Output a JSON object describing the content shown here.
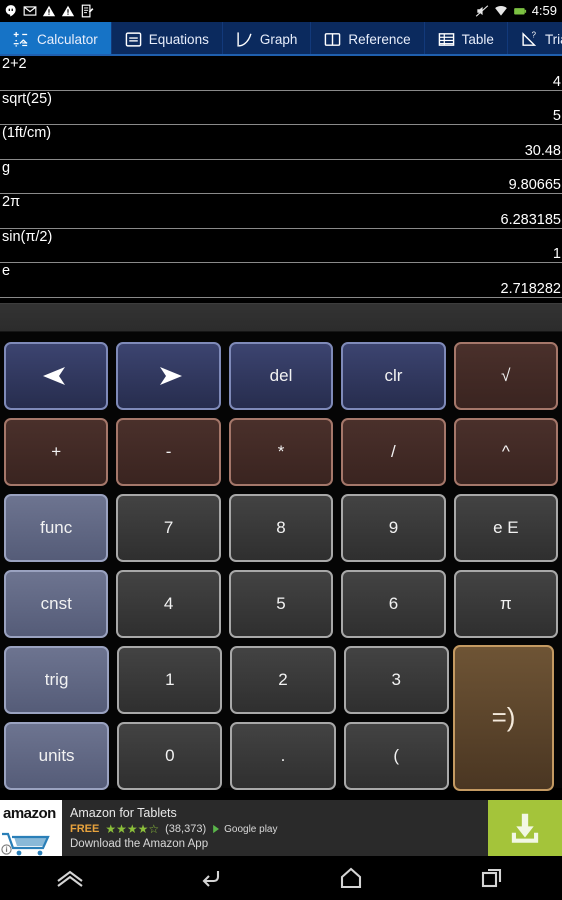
{
  "status_bar": {
    "left_icons": [
      "hangouts-icon",
      "gmail-icon",
      "warning-icon",
      "warning-icon",
      "notes-icon"
    ],
    "right_icons": [
      "mute-icon",
      "wifi-icon",
      "battery-icon"
    ],
    "clock": "4:59"
  },
  "tabs": [
    {
      "label": "Calculator",
      "icon": "calculator-icon",
      "active": true
    },
    {
      "label": "Equations",
      "icon": "equations-icon",
      "active": false
    },
    {
      "label": "Graph",
      "icon": "graph-icon",
      "active": false
    },
    {
      "label": "Reference",
      "icon": "book-icon",
      "active": false
    },
    {
      "label": "Table",
      "icon": "table-icon",
      "active": false
    },
    {
      "label": "Triangle",
      "icon": "triangle-icon",
      "active": false
    }
  ],
  "history": [
    {
      "expression": "2+2",
      "result": "4"
    },
    {
      "expression": "sqrt(25)",
      "result": "5"
    },
    {
      "expression": "(1ft/cm)",
      "result": "30.48"
    },
    {
      "expression": "g",
      "result": "9.80665"
    },
    {
      "expression": "2π",
      "result": "6.283185"
    },
    {
      "expression": "sin(π/2)",
      "result": "1"
    },
    {
      "expression": "e",
      "result": "2.718282"
    }
  ],
  "input": {
    "value": "",
    "placeholder": ""
  },
  "keypad": {
    "rows": [
      [
        {
          "label": "",
          "icon": "arrow-left-icon",
          "style": "k-nav",
          "name": "key-cursor-left"
        },
        {
          "label": "",
          "icon": "arrow-right-icon",
          "style": "k-nav",
          "name": "key-cursor-right"
        },
        {
          "label": "del",
          "icon": "",
          "style": "k-nav",
          "name": "key-delete"
        },
        {
          "label": "clr",
          "icon": "",
          "style": "k-nav",
          "name": "key-clear"
        },
        {
          "label": "√",
          "icon": "",
          "style": "k-op",
          "name": "key-sqrt"
        }
      ],
      [
        {
          "label": "+",
          "icon": "",
          "style": "k-op",
          "name": "key-plus"
        },
        {
          "label": "-",
          "icon": "",
          "style": "k-op",
          "name": "key-minus"
        },
        {
          "label": "*",
          "icon": "",
          "style": "k-op",
          "name": "key-multiply"
        },
        {
          "label": "/",
          "icon": "",
          "style": "k-op",
          "name": "key-divide"
        },
        {
          "label": "^",
          "icon": "",
          "style": "k-op",
          "name": "key-power"
        }
      ],
      [
        {
          "label": "func",
          "icon": "",
          "style": "k-side",
          "name": "key-func"
        },
        {
          "label": "7",
          "icon": "",
          "style": "k-num",
          "name": "key-7"
        },
        {
          "label": "8",
          "icon": "",
          "style": "k-num",
          "name": "key-8"
        },
        {
          "label": "9",
          "icon": "",
          "style": "k-num",
          "name": "key-9"
        },
        {
          "label": "e E",
          "icon": "",
          "style": "k-num",
          "name": "key-exponent"
        }
      ],
      [
        {
          "label": "cnst",
          "icon": "",
          "style": "k-side",
          "name": "key-constants"
        },
        {
          "label": "4",
          "icon": "",
          "style": "k-num",
          "name": "key-4"
        },
        {
          "label": "5",
          "icon": "",
          "style": "k-num",
          "name": "key-5"
        },
        {
          "label": "6",
          "icon": "",
          "style": "k-num",
          "name": "key-6"
        },
        {
          "label": "π",
          "icon": "",
          "style": "k-num",
          "name": "key-pi"
        }
      ],
      [
        {
          "label": "trig",
          "icon": "",
          "style": "k-side",
          "name": "key-trig"
        },
        {
          "label": "1",
          "icon": "",
          "style": "k-num",
          "name": "key-1"
        },
        {
          "label": "2",
          "icon": "",
          "style": "k-num",
          "name": "key-2"
        },
        {
          "label": "3",
          "icon": "",
          "style": "k-num",
          "name": "key-3"
        }
      ],
      [
        {
          "label": "units",
          "icon": "",
          "style": "k-side",
          "name": "key-units"
        },
        {
          "label": "0",
          "icon": "",
          "style": "k-num",
          "name": "key-0"
        },
        {
          "label": ".",
          "icon": "",
          "style": "k-num",
          "name": "key-decimal"
        },
        {
          "label": "(",
          "icon": "",
          "style": "k-num",
          "name": "key-open-paren"
        }
      ]
    ],
    "equals_label": "=)"
  },
  "ad": {
    "title": "Amazon for Tablets",
    "price": "FREE",
    "stars": "★★★★☆",
    "rating_count": "(38,373)",
    "store": "Google play",
    "subtitle": "Download the Amazon App",
    "logo_text": "amazon",
    "download_icon": "download-icon"
  },
  "nav_bar": {
    "buttons": [
      "app-drawer-icon",
      "back-icon",
      "home-icon",
      "recents-icon"
    ]
  },
  "colors": {
    "tab_active": "#1673c6",
    "tab_bar": "#0b2a5e",
    "ad_accent": "#a4c43a",
    "price": "#e8a33d",
    "stars": "#8bbf3a"
  }
}
